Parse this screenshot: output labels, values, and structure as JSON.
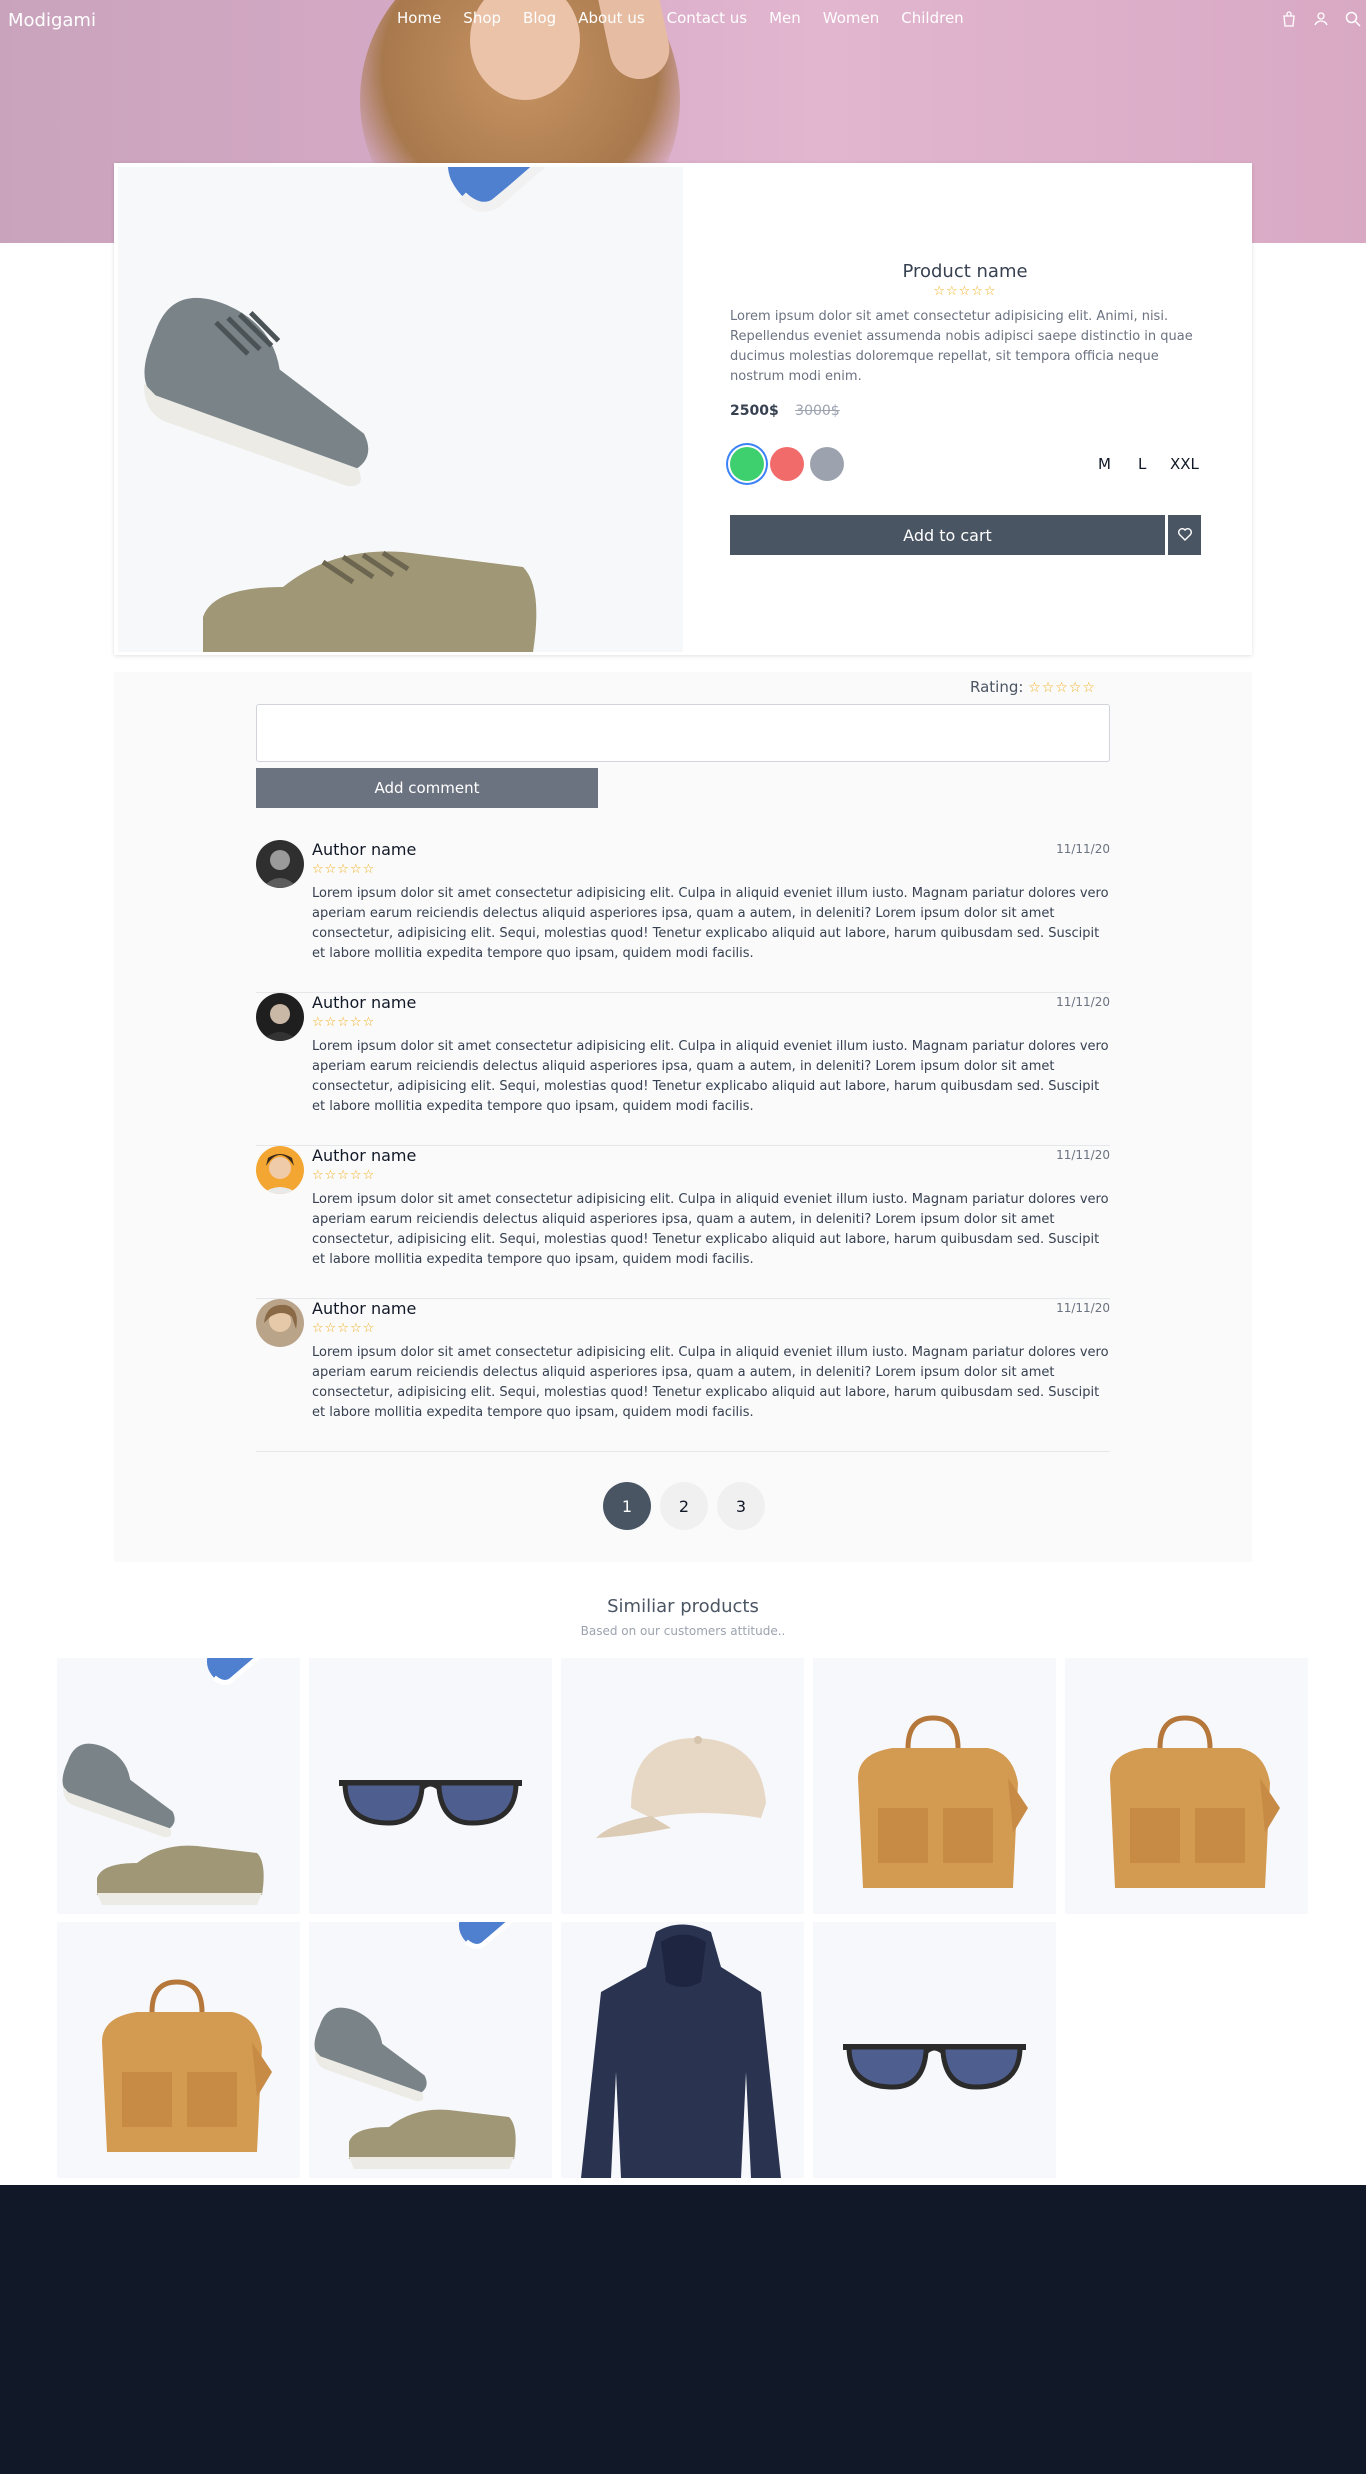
{
  "nav": {
    "brand": "Modigami",
    "links": [
      "Home",
      "Shop",
      "Blog",
      "About us",
      "Contact us",
      "Men",
      "Women",
      "Children"
    ],
    "icons": [
      "bag-icon",
      "user-icon",
      "search-icon"
    ]
  },
  "product": {
    "name": "Product name",
    "rating_stars": "☆☆☆☆☆",
    "description": "Lorem ipsum dolor sit amet consectetur adipisicing elit. Animi, nisi. Repellendus eveniet assumenda nobis adipisci saepe distinctio in quae ducimus molestias doloremque repellat, sit tempora officia neque nostrum modi enim.",
    "price": "2500$",
    "old_price": "3000$",
    "colors": [
      "#3ecf6f",
      "#f26b6b",
      "#9ca3af"
    ],
    "selected_color": 0,
    "sizes": [
      "M",
      "L",
      "XXL"
    ],
    "add_to_cart": "Add to cart"
  },
  "reviews": {
    "rating_label": "Rating:",
    "rating_stars": "☆☆☆☆☆",
    "comment_placeholder": "",
    "add_comment": "Add comment",
    "items": [
      {
        "author": "Author name",
        "date": "11/11/20",
        "stars": "☆☆☆☆☆",
        "text": "Lorem ipsum dolor sit amet consectetur adipisicing elit. Culpa in aliquid eveniet illum iusto. Magnam pariatur dolores vero aperiam earum reiciendis delectus aliquid asperiores ipsa, quam a autem, in deleniti? Lorem ipsum dolor sit amet consectetur, adipisicing elit. Sequi, molestias quod! Tenetur explicabo aliquid aut labore, harum quibusdam sed. Suscipit et labore mollitia expedita tempore quo ipsam, quidem modi facilis."
      },
      {
        "author": "Author name",
        "date": "11/11/20",
        "stars": "☆☆☆☆☆",
        "text": "Lorem ipsum dolor sit amet consectetur adipisicing elit. Culpa in aliquid eveniet illum iusto. Magnam pariatur dolores vero aperiam earum reiciendis delectus aliquid asperiores ipsa, quam a autem, in deleniti? Lorem ipsum dolor sit amet consectetur, adipisicing elit. Sequi, molestias quod! Tenetur explicabo aliquid aut labore, harum quibusdam sed. Suscipit et labore mollitia expedita tempore quo ipsam, quidem modi facilis."
      },
      {
        "author": "Author name",
        "date": "11/11/20",
        "stars": "☆☆☆☆☆",
        "text": "Lorem ipsum dolor sit amet consectetur adipisicing elit. Culpa in aliquid eveniet illum iusto. Magnam pariatur dolores vero aperiam earum reiciendis delectus aliquid asperiores ipsa, quam a autem, in deleniti? Lorem ipsum dolor sit amet consectetur, adipisicing elit. Sequi, molestias quod! Tenetur explicabo aliquid aut labore, harum quibusdam sed. Suscipit et labore mollitia expedita tempore quo ipsam, quidem modi facilis."
      },
      {
        "author": "Author name",
        "date": "11/11/20",
        "stars": "☆☆☆☆☆",
        "text": "Lorem ipsum dolor sit amet consectetur adipisicing elit. Culpa in aliquid eveniet illum iusto. Magnam pariatur dolores vero aperiam earum reiciendis delectus aliquid asperiores ipsa, quam a autem, in deleniti? Lorem ipsum dolor sit amet consectetur, adipisicing elit. Sequi, molestias quod! Tenetur explicabo aliquid aut labore, harum quibusdam sed. Suscipit et labore mollitia expedita tempore quo ipsam, quidem modi facilis."
      }
    ],
    "pages": [
      "1",
      "2",
      "3"
    ],
    "active_page": 0
  },
  "similar": {
    "title": "Similiar products",
    "subtitle": "Based on our customers attitude..",
    "items": [
      "shoes",
      "sunglasses",
      "cap",
      "bag",
      "bag",
      "bag",
      "shoes",
      "hoodie",
      "sunglasses"
    ]
  }
}
